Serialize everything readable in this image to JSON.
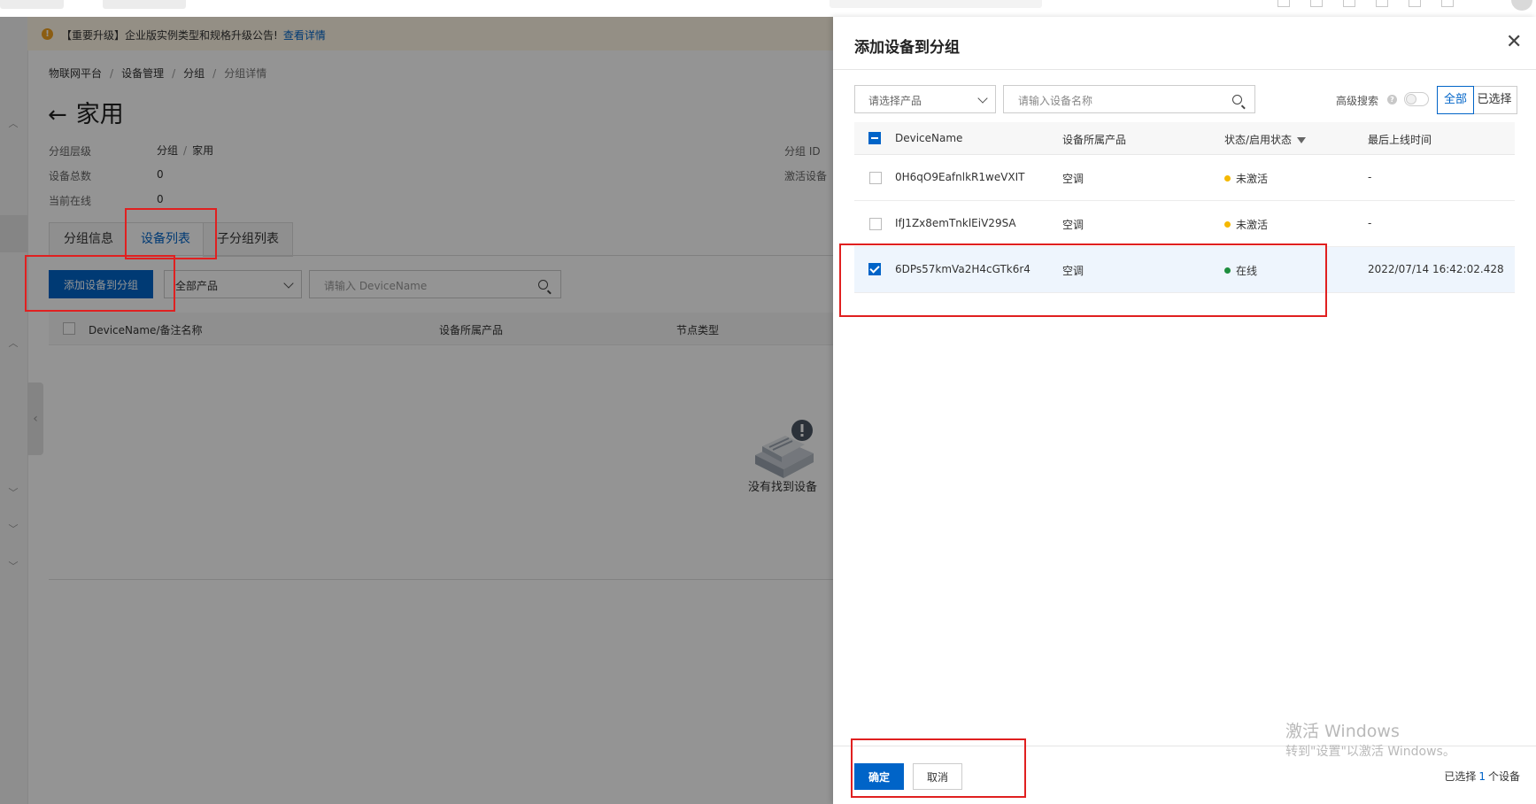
{
  "notice": {
    "text": "【重要升级】企业版实例类型和规格升级公告!",
    "link": "查看详情"
  },
  "breadcrumb": [
    "物联网平台",
    "设备管理",
    "分组",
    "分组详情"
  ],
  "page": {
    "title": "家用",
    "meta": {
      "level_label": "分组层级",
      "level_root": "分组",
      "level_current": "家用",
      "total_label": "设备总数",
      "total_value": "0",
      "online_label": "当前在线",
      "online_value": "0",
      "group_id_label": "分组 ID",
      "activated_label": "激活设备"
    },
    "tabs": [
      "分组信息",
      "设备列表",
      "子分组列表"
    ],
    "active_tab": "设备列表"
  },
  "device_list": {
    "add_button": "添加设备到分组",
    "product_select": "全部产品",
    "search_placeholder": "请输入 DeviceName",
    "columns": [
      "DeviceName/备注名称",
      "设备所属产品",
      "节点类型"
    ],
    "empty_text": "没有找到设备"
  },
  "drawer": {
    "title": "添加设备到分组",
    "product_select_placeholder": "请选择产品",
    "device_search_placeholder": "请输入设备名称",
    "advanced_search_label": "高级搜索",
    "filter_all": "全部",
    "filter_selected": "已选择",
    "columns": [
      "DeviceName",
      "设备所属产品",
      "状态/启用状态",
      "最后上线时间"
    ],
    "rows": [
      {
        "name": "0H6qO9EafnlkR1weVXIT",
        "product": "空调",
        "status": "未激活",
        "status_color": "#f5b800",
        "last_online": "-",
        "checked": false
      },
      {
        "name": "IfJ1Zx8emTnklEiV29SA",
        "product": "空调",
        "status": "未激活",
        "status_color": "#f5b800",
        "last_online": "-",
        "checked": false
      },
      {
        "name": "6DPs57kmVa2H4cGTk6r4",
        "product": "空调",
        "status": "在线",
        "status_color": "#1e8e3e",
        "last_online": "2022/07/14 16:42:02.428",
        "checked": true
      }
    ],
    "confirm_button": "确定",
    "cancel_button": "取消",
    "selected_prefix": "已选择",
    "selected_count": "1",
    "selected_suffix": "个设备"
  },
  "watermark": {
    "line1": "激活 Windows",
    "line2": "转到\"设置\"以激活 Windows。"
  },
  "colors": {
    "primary": "#0064c8",
    "annotation": "#e02020",
    "notice_bg": "#fff7e6"
  }
}
